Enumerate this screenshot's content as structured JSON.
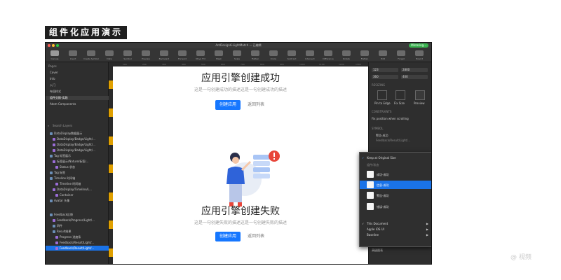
{
  "banner": {
    "label": "组件化应用演示"
  },
  "window": {
    "title": "AntDesign6-LightMatch — 已编辑",
    "mirror_badge": "Mirroring...",
    "colors": {
      "traffic_red": "#ff5f57",
      "traffic_yellow": "#febc2e",
      "traffic_green": "#28c840",
      "accent": "#1a73e8",
      "primary_button": "#1677ff"
    }
  },
  "toolbar": {
    "items": [
      {
        "label": "Canvas",
        "icon": "canvas-icon"
      },
      {
        "label": "Insert",
        "icon": "plus-icon"
      },
      {
        "label": "Create Symbol",
        "icon": "symbol-icon"
      },
      {
        "label": "Data",
        "icon": "data-icon"
      },
      {
        "label": "Symbol",
        "icon": "symbol-icon"
      },
      {
        "label": "Preview",
        "icon": "preview-icon"
      },
      {
        "label": "Backward",
        "icon": "backward-icon"
      },
      {
        "label": "Forward",
        "icon": "forward-icon"
      },
      {
        "label": "Move Frd",
        "icon": "move-icon"
      },
      {
        "label": "Mask",
        "icon": "mask-icon"
      },
      {
        "label": "Scale",
        "icon": "scale-icon"
      },
      {
        "label": "Flatten",
        "icon": "flatten-icon"
      },
      {
        "label": "Union",
        "icon": "union-icon"
      },
      {
        "label": "Subtract",
        "icon": "subtract-icon"
      },
      {
        "label": "Intersect",
        "icon": "intersect-icon"
      },
      {
        "label": "Difference",
        "icon": "difference-icon"
      },
      {
        "label": "Rotate",
        "icon": "rotate-icon"
      },
      {
        "label": "Flatten",
        "icon": "flatten-icon"
      },
      {
        "label": "Edit",
        "icon": "edit-icon"
      },
      {
        "label": "Forget",
        "icon": "forget-icon"
      },
      {
        "label": "Export",
        "icon": "export-icon"
      }
    ]
  },
  "sidebar": {
    "pages_heading": "Pages",
    "pages": [
      "Cover",
      "Info",
      "入门",
      "布局样式",
      "组件交换-实践",
      "Atom-Components"
    ],
    "search_placeholder": "Search Layers",
    "layers": [
      "DataDisplay数据展示",
      "DataDisplay/Badge/Light/...",
      "DataDisplay/Badge/Light/...",
      "DataDisplay/Badge/Light/...",
      "Tag 标签展示",
      "标签展示/Nature/标签/...",
      "Status 状态",
      "Tag 标签",
      "Timeline 时间轴",
      "Timeline 时间轴",
      "DataDisplay/Timeline/L...",
      "Container",
      "Avatar 头像",
      "Feedback反馈",
      "Feedback/Progress/Light/...",
      "四件",
      "Result结果",
      "Progress 进度条",
      "Feedback/Result/Light/...",
      "Feedback/Result/Light/..."
    ]
  },
  "canvas": {
    "ruler_numbers": [
      "100",
      "200",
      "300",
      "400",
      "500",
      "600",
      "700",
      "800",
      "900",
      "1000",
      "1100",
      "1200",
      "1300"
    ],
    "success_title": "应用引擎创建成功",
    "success_desc": "这是一句创建成功的描述这是一句创建成功的描述",
    "success_primary": "创建应用",
    "success_link": "返回列表",
    "fail_title": "应用引擎创建失败",
    "fail_desc": "这是一句创建失败的描述这是一句创建失败的描述",
    "fail_primary": "创建应用",
    "fail_link": "返回列表"
  },
  "inspector": {
    "x": "123",
    "y": "2800",
    "w": "360",
    "h": "400",
    "resizing_label": "RESIZING",
    "pin_label": "Pin to Edge",
    "fix_label": "Fix Size",
    "preview_label": "Preview",
    "constraints_label": "CONSTRAINTS",
    "fix_position": "Fix position when scrolling",
    "symbol_label": "SYMBOL",
    "symbol_name": "警告-成功",
    "symbol_path": "Feedback/Result/Light/...",
    "bottom_label": "高级图表"
  },
  "popup": {
    "keep_label": "Keep at Original Size",
    "section": "组件/状态",
    "items": [
      {
        "label": "成功-成功",
        "selected": false
      },
      {
        "label": "信息-成功",
        "selected": true
      },
      {
        "label": "警告-成功",
        "selected": false
      },
      {
        "label": "错误-成功",
        "selected": false
      }
    ],
    "libraries": [
      "This Document",
      "Apple iOS UI",
      "Baseline"
    ]
  },
  "watermark": "@ 视频"
}
